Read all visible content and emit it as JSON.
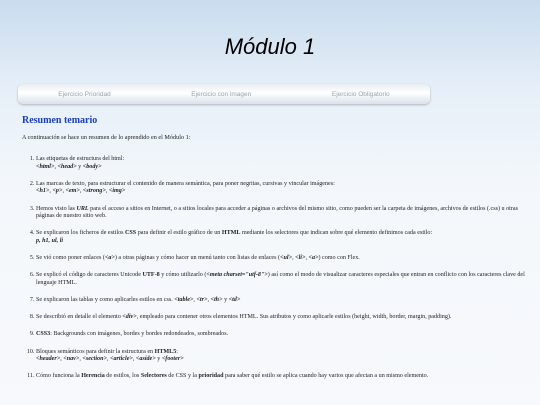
{
  "page": {
    "title": "Módulo 1",
    "section_title": "Resumen temario",
    "intro": "A continuación se hace un resumen de lo aprendido en el Módulo 1:"
  },
  "nav": {
    "items": [
      {
        "label": "Ejercicio Prioridad"
      },
      {
        "label": "Ejercicio con imagen"
      },
      {
        "label": "Ejercicio Obligatorio"
      }
    ]
  },
  "items": [
    {
      "t1": "Las etiquetas de estructura del html:",
      "c1": "<html>",
      "t2": ", ",
      "c2": "<head>",
      "t3": " y ",
      "c3": "<body>"
    },
    {
      "t1": "Las marcas de texto, para estructurar el contenido de manera semántica, para poner negritas, cursivas y vincular imágenes:",
      "c1": "<h1>",
      "t2": ", ",
      "c2": "<p>",
      "t3": ", ",
      "c3": "<em>",
      "t4": ", ",
      "c4": "<strong>",
      "t5": ", ",
      "c5": "<img>"
    },
    {
      "t1": "Hemos visto las ",
      "c1": "URL",
      "t2": " para el acceso a sitios en Internet, o a sitios locales para acceder a páginas o archivos del mismo sitio, como pueden ser la carpeta de imágenes, archivos de estilos (.css) u otras páginas de nuestro sitio web."
    },
    {
      "t1": "Se explicaron los ficheros de estilos ",
      "c1": "CSS",
      "t2": " para definir el estilo gráfico de un ",
      "c2": "HTML",
      "t3": " mediante los selectores que indican sobre qué elemento definimos cada estilo:",
      "c3": "p, h1, ul, li"
    },
    {
      "t1": "Se vió como poner enlaces (",
      "c1": "<a>",
      "t2": ") a otras páginas y cómo hacer un menú tanto con listas de enlaces (",
      "c2": "<ul>",
      "t3": ", ",
      "c3": "<li>",
      "t4": ", ",
      "c4": "<a>",
      "t5": ") como con Flex."
    },
    {
      "t1": "Se explicó el código de caracteres Unicode ",
      "c1": "UTF-8",
      "t2": " y cómo utilizarlo (",
      "c2": "<meta charset=\"utf-8\">",
      "t3": ") así como el modo de visualizar caracteres especiales que entran en conflicto con los caracteres clave del lenguaje HTML."
    },
    {
      "t1": "Se explicaron las tablas y como aplicarles estilos en css. ",
      "c1": "<table>",
      "t2": ", ",
      "c2": "<tr>",
      "t3": ", ",
      "c3": "<th>",
      "t4": " y ",
      "c4": "<td>"
    },
    {
      "t1": "Se describió en detalle el elemento ",
      "c1": "<div>",
      "t2": ", empleado para contener otros elementos HTML. Sus atributos y como aplicarle estilos (height, width, border, margin, padding)."
    },
    {
      "c1": "CSS3",
      "t1": ": Backgrounds con imágenes, bordes y bordes redondeados, sombreados."
    },
    {
      "t1": "Bloques semánticos para definir la estructura en ",
      "c1": "HTML5",
      "t2": ":",
      "c2": "<header>",
      "t3": ", ",
      "c3": "<nav>",
      "t4": ", ",
      "c4": "<section>",
      "t5": ", ",
      "c5": "<article>",
      "t6": ", ",
      "c6": "<aside>",
      "t7": " y ",
      "c7": "<footer>"
    },
    {
      "t1": "Cómo funciona la ",
      "c1": "Herencia",
      "t2": " de estilos, los ",
      "c2": "Selectores",
      "t3": " de CSS y la ",
      "c3": "prioridad",
      "t4": " para saber qué estilo se aplica cuando hay varios que afectan a un mismo elemento."
    }
  ]
}
